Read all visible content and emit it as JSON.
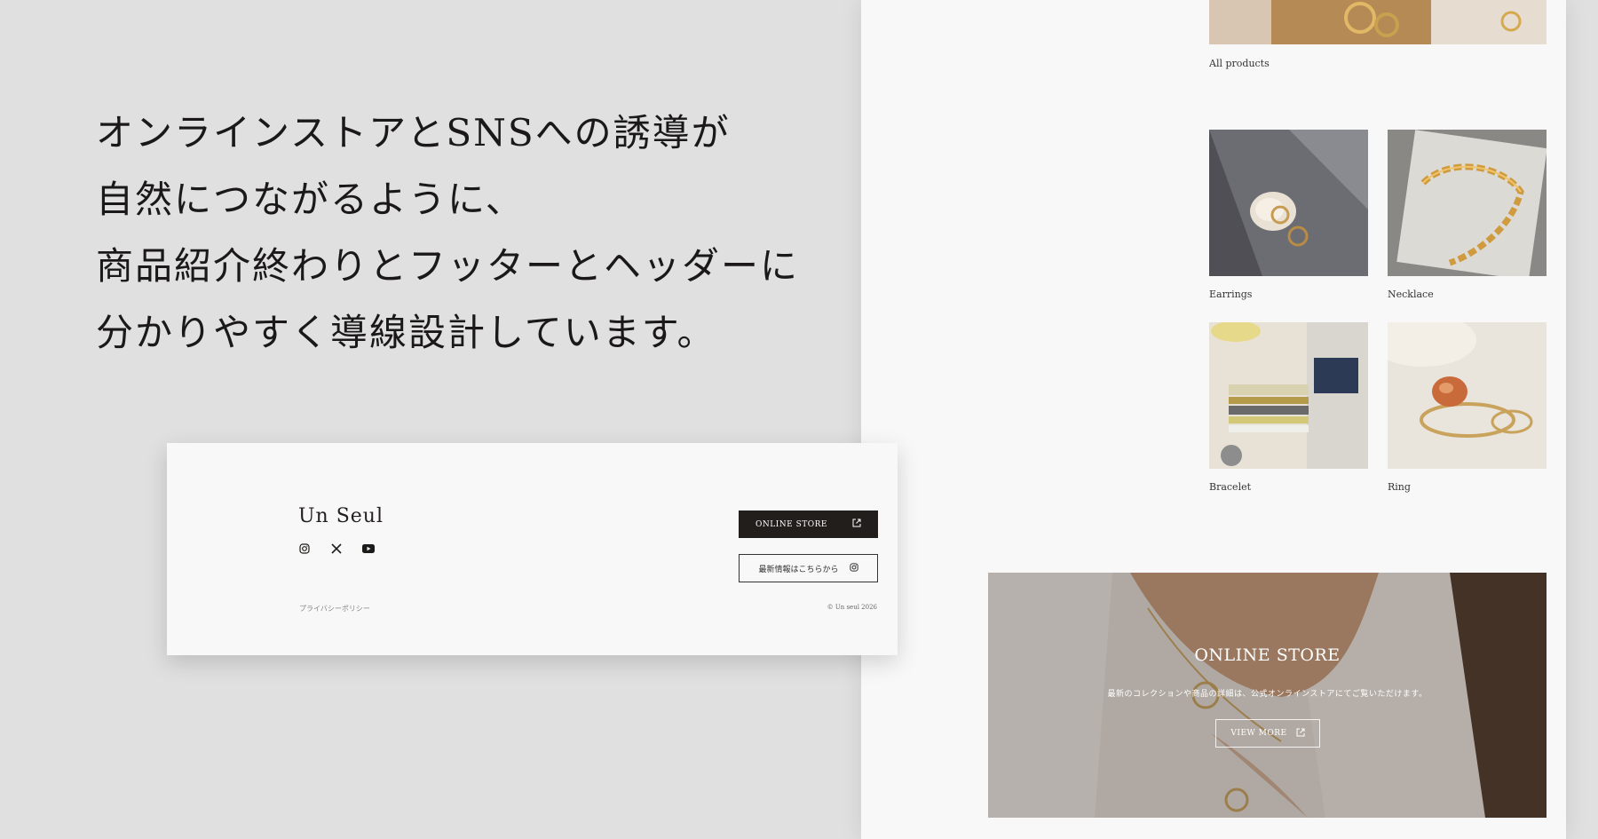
{
  "headline": {
    "lines": [
      "オンラインストアとSNSへの誘導が",
      "自然につながるように、",
      "商品紹介終わりとフッターとヘッダーに",
      "分かりやすく導線設計しています。"
    ]
  },
  "products": {
    "all_label": "All products",
    "categories": [
      {
        "label": "Earrings",
        "icon": "earrings-photo"
      },
      {
        "label": "Necklace",
        "icon": "necklace-photo"
      },
      {
        "label": "Bracelet",
        "icon": "bracelet-photo"
      },
      {
        "label": "Ring",
        "icon": "ring-photo"
      }
    ]
  },
  "banner": {
    "title": "ONLINE STORE",
    "description": "最新のコレクションや商品の詳細は、公式オンラインストアにてご覧いただけます。",
    "button_label": "VIEW MORE",
    "button_icon": "external-link-icon"
  },
  "footer": {
    "brand": "Un Seul",
    "social_icons": [
      "instagram-icon",
      "x-icon",
      "youtube-icon"
    ],
    "store_button_label": "ONLINE STORE",
    "news_button_label": "最新情報はこちらから",
    "privacy_label": "プライバシーポリシー",
    "copyright": "© Un seul 2026"
  },
  "colors": {
    "background": "#e0e0e0",
    "panel": "#f8f8f8",
    "dark_button": "#221e1c",
    "text": "#1d1b1a"
  }
}
